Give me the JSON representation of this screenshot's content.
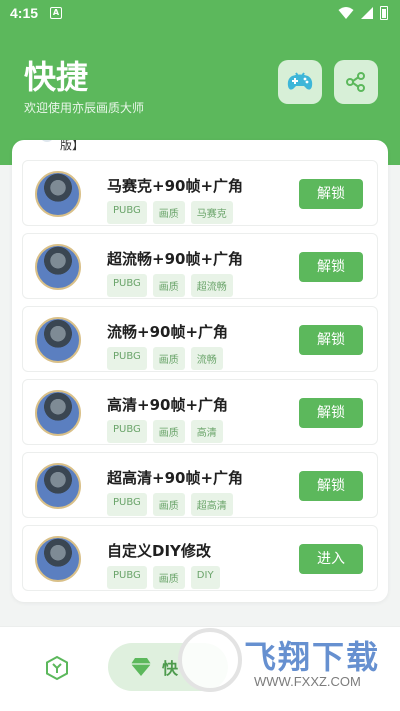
{
  "status": {
    "time": "4:15",
    "notif": "A"
  },
  "header": {
    "title": "快捷",
    "subtitle": "欢迎使用亦辰画质大师",
    "bg_color": "#5cb85c",
    "buttons": [
      {
        "icon": "gamepad-icon"
      },
      {
        "icon": "share-icon"
      }
    ]
  },
  "card": {
    "peek_text": "版】",
    "items": [
      {
        "title": "马赛克+90帧+广角",
        "tags": [
          "PUBG",
          "画质",
          "马赛克"
        ],
        "action": "解锁"
      },
      {
        "title": "超流畅+90帧+广角",
        "tags": [
          "PUBG",
          "画质",
          "超流畅"
        ],
        "action": "解锁"
      },
      {
        "title": "流畅+90帧+广角",
        "tags": [
          "PUBG",
          "画质",
          "流畅"
        ],
        "action": "解锁"
      },
      {
        "title": "高清+90帧+广角",
        "tags": [
          "PUBG",
          "画质",
          "高清"
        ],
        "action": "解锁"
      },
      {
        "title": "超高清+90帧+广角",
        "tags": [
          "PUBG",
          "画质",
          "超高清"
        ],
        "action": "解锁"
      },
      {
        "title": "自定义DIY修改",
        "tags": [
          "PUBG",
          "画质",
          "DIY"
        ],
        "action": "进入"
      }
    ]
  },
  "bottom_nav": {
    "active_label": "快",
    "accent": "#5cb85c"
  },
  "watermark": {
    "text": "飞翔下载",
    "url": "WWW.FXXZ.COM"
  }
}
